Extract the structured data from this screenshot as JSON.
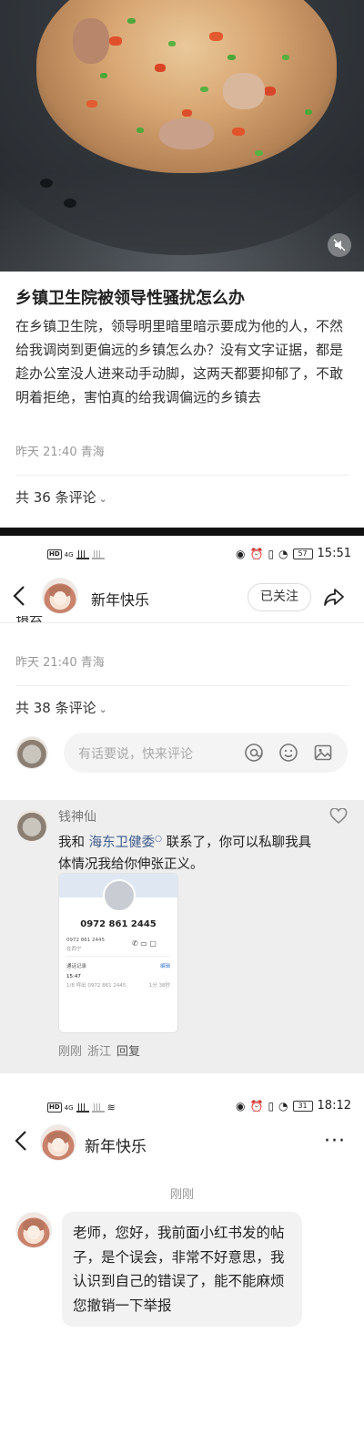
{
  "post": {
    "title": "乡镇卫生院被领导性骚扰怎么办",
    "body": "在乡镇卫生院，领导明里暗里暗示要成为他的人，不然给我调岗到更偏远的乡镇怎么办？没有文字证据，都是趁办公室没人进来动手动脚，这两天都要抑郁了，不敢明着拒绝，害怕真的给我调偏远的乡镇去",
    "meta": "昨天 21:40 青海",
    "comment_count": "共 36 条评论"
  },
  "screen2": {
    "status": {
      "time": "15:51",
      "battery": "57",
      "net": "4G"
    },
    "nav": {
      "name": "新年快乐",
      "follow": "已关注"
    },
    "cut_text": "镇去",
    "meta": "昨天 21:40 青海",
    "comment_count": "共 38 条评论",
    "input_placeholder": "有话要说，快来评论",
    "comment": {
      "name": "钱神仙",
      "text_before": "我和 ",
      "link": "海东卫健委",
      "text_after": " 联系了，你可以私聊我具体情况我给你伸张正义。",
      "shot": {
        "number": "0972 861 2445",
        "row1": "0972 861 2445",
        "row1_sub": "在西宁",
        "row2_title": "通话记录",
        "row2_right": "编辑",
        "row3": "15:47",
        "row3_sub": "1/8 呼出 0972 861 2445",
        "row3_right": "1分 38秒"
      },
      "time": "刚刚",
      "location": "浙江",
      "reply": "回复"
    }
  },
  "screen3": {
    "status": {
      "time": "18:12",
      "battery": "31",
      "net": "4G"
    },
    "nav": {
      "name": "新年快乐"
    },
    "time_label": "刚刚",
    "message": "老师，您好，我前面小红书发的帖子，是个误会，非常不好意思，我认识到自己的错误了，能不能麻烦您撤销一下举报"
  },
  "icons": [
    "volume-mute-icon",
    "back-icon",
    "share-icon",
    "at-icon",
    "emoji-icon",
    "image-icon",
    "heart-icon",
    "more-icon",
    "chevron-down-icon"
  ],
  "colors": {
    "link": "#3c5a8a",
    "meta": "#999999",
    "separator": "#111111",
    "comment_bg": "#eeeeee"
  }
}
